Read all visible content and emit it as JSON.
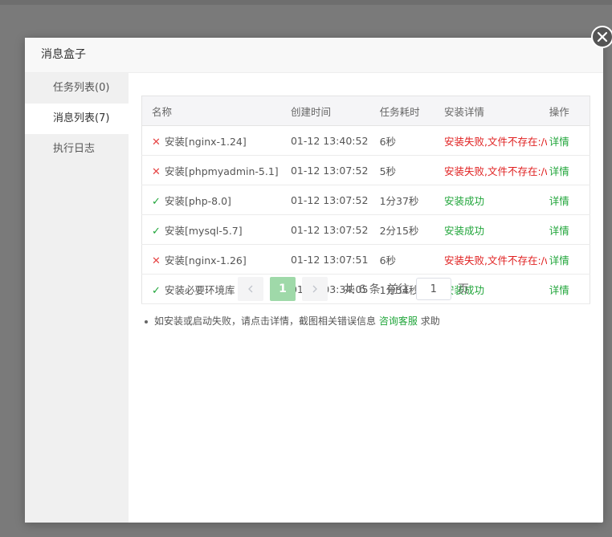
{
  "dialog": {
    "title": "消息盒子"
  },
  "sidebar": {
    "items": [
      {
        "label": "任务列表(0)"
      },
      {
        "label": "消息列表(7)"
      },
      {
        "label": "执行日志"
      }
    ]
  },
  "table": {
    "headers": [
      "名称",
      "创建时间",
      "任务耗时",
      "安装详情",
      "操作"
    ],
    "rows": [
      {
        "status": "fail",
        "name": "安装[nginx-1.24]",
        "time": "01-12 13:40:52",
        "duration": "6秒",
        "detail": "安装失败,文件不存在:/w",
        "op": "详情"
      },
      {
        "status": "fail",
        "name": "安装[phpmyadmin-5.1]",
        "time": "01-12 13:07:52",
        "duration": "5秒",
        "detail": "安装失败,文件不存在:/w",
        "op": "详情"
      },
      {
        "status": "ok",
        "name": "安装[php-8.0]",
        "time": "01-12 13:07:52",
        "duration": "1分37秒",
        "detail": "安装成功",
        "op": "详情"
      },
      {
        "status": "ok",
        "name": "安装[mysql-5.7]",
        "time": "01-12 13:07:52",
        "duration": "2分15秒",
        "detail": "安装成功",
        "op": "详情"
      },
      {
        "status": "fail",
        "name": "安装[nginx-1.26]",
        "time": "01-12 13:07:51",
        "duration": "6秒",
        "detail": "安装失败,文件不存在:/w",
        "op": "详情"
      },
      {
        "status": "ok",
        "name": "安装必要环境库",
        "time": "01-09 03:34:05",
        "duration": "1分54秒",
        "detail": "安装成功",
        "op": "详情"
      }
    ]
  },
  "tip": {
    "prefix": "如安装或启动失败，请点击详情，截图相关错误信息",
    "link": "咨询客服",
    "suffix": "求助"
  },
  "pager": {
    "current": "1",
    "total_text": "共 6 条",
    "goto_label": "前往",
    "goto_value": "1",
    "page_unit": "页"
  },
  "colors": {
    "accent": "#20a53a",
    "error": "#e02020"
  }
}
